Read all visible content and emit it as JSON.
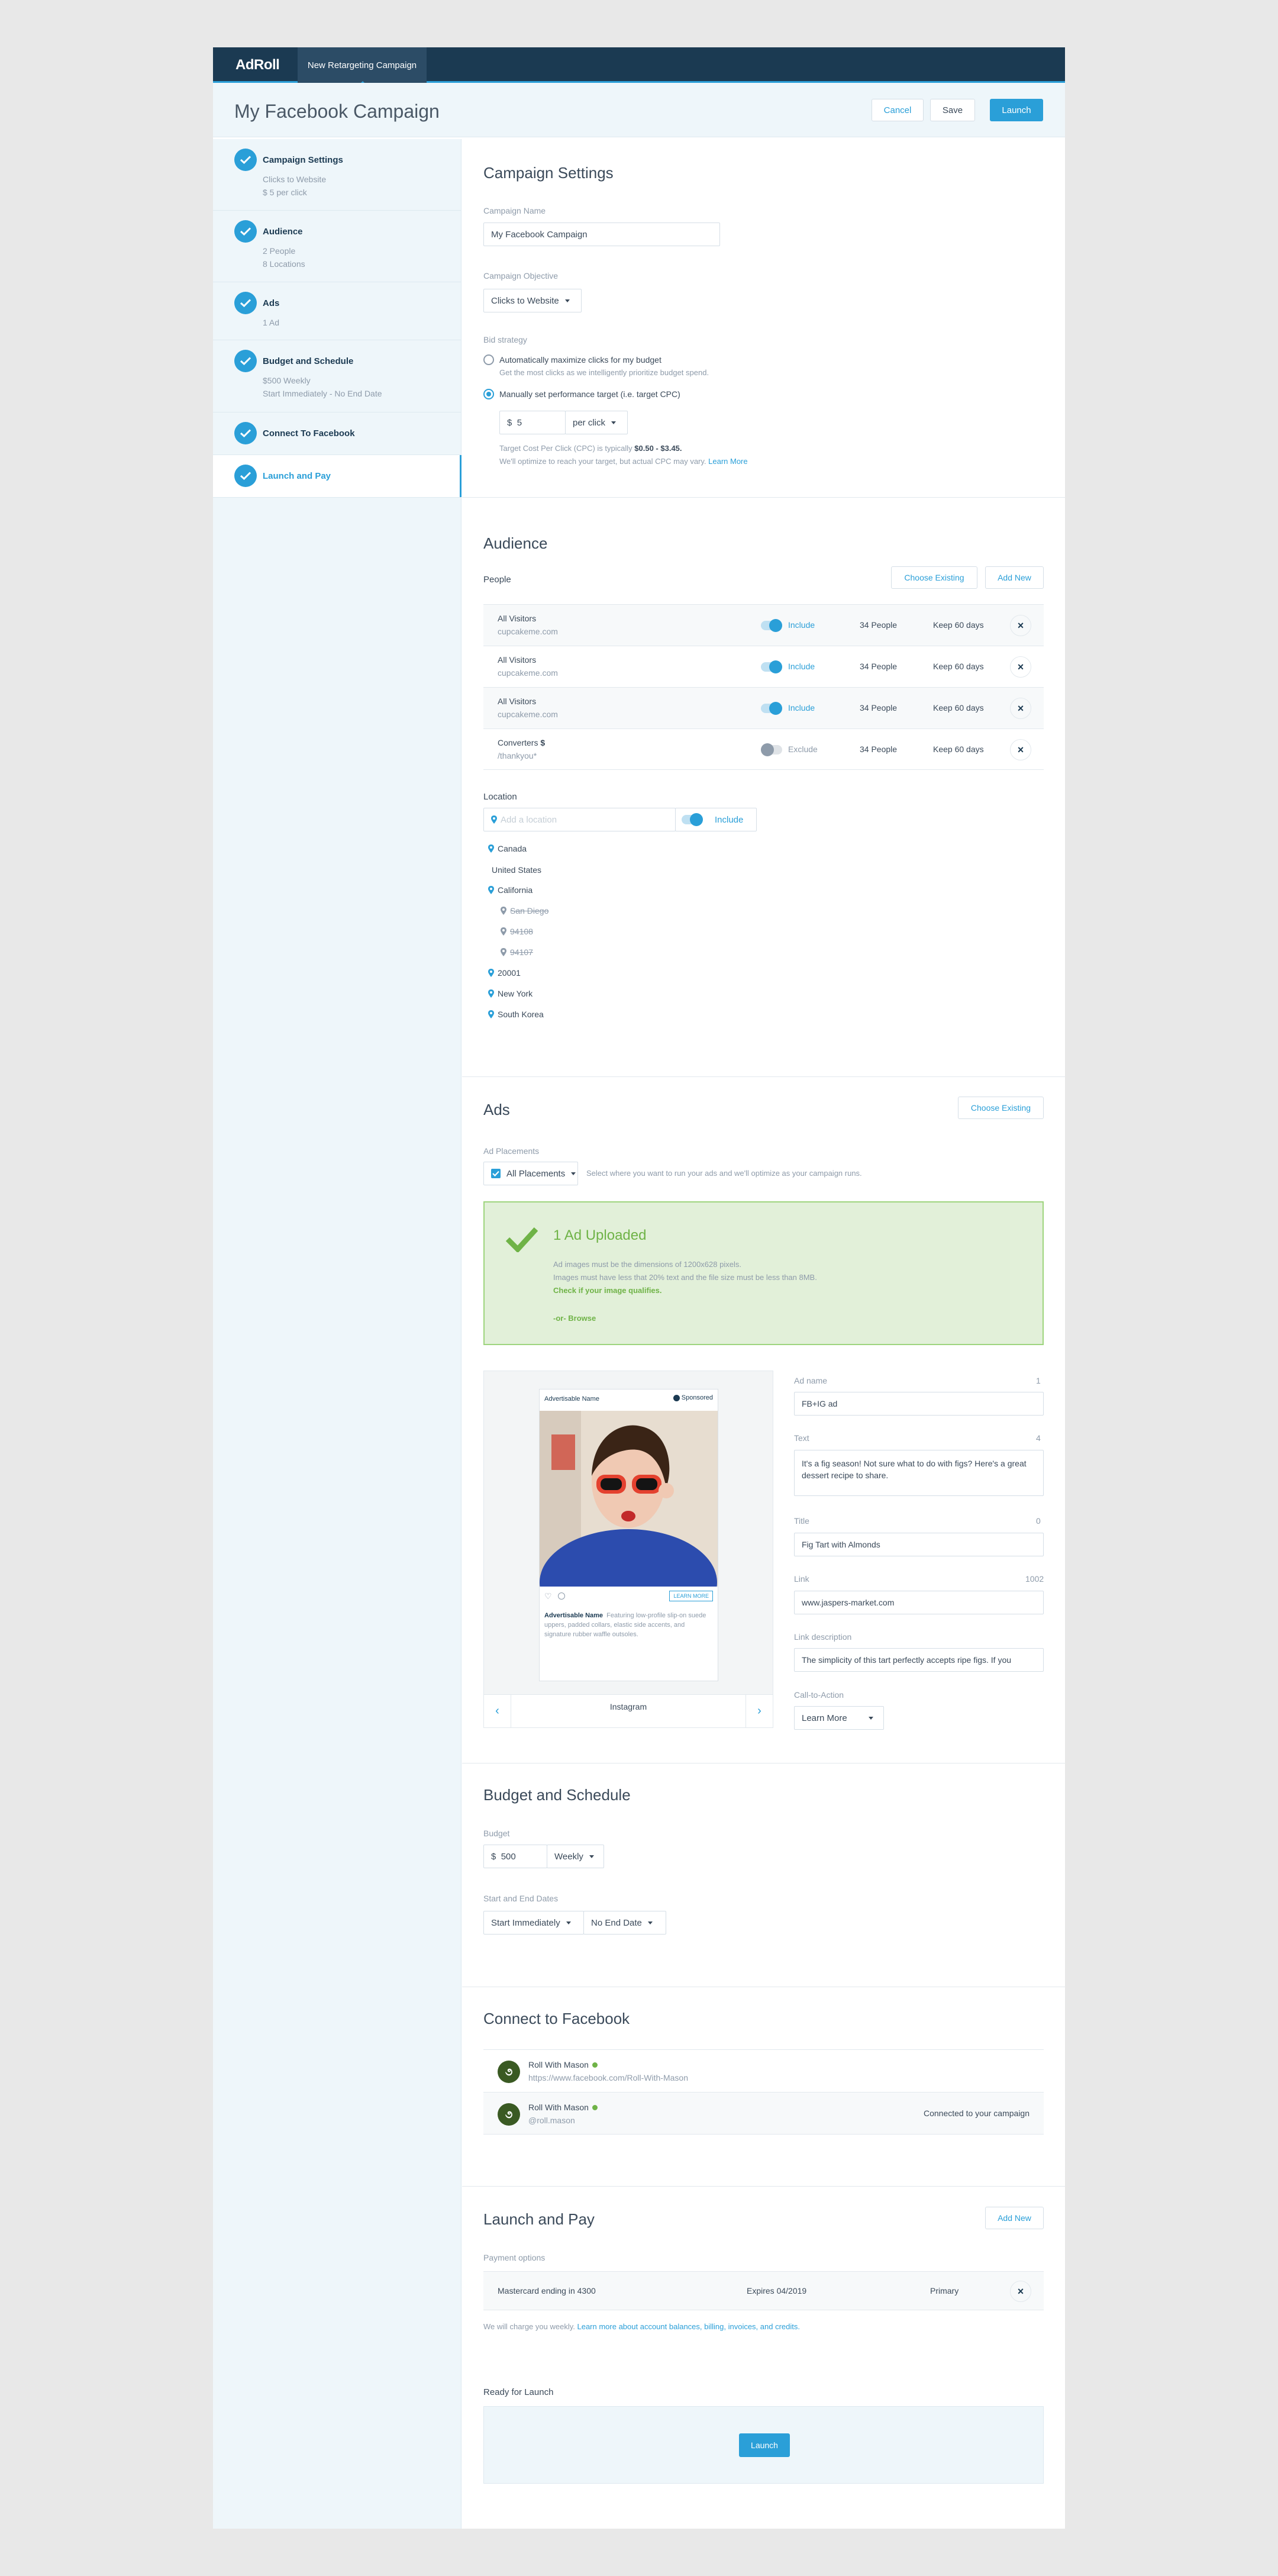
{
  "topbar": {
    "logo": "AdRoll",
    "tab": "New Retargeting Campaign"
  },
  "header": {
    "title": "My Facebook Campaign",
    "cancel": "Cancel",
    "save": "Save",
    "launch": "Launch"
  },
  "sidebar": {
    "steps": [
      {
        "title": "Campaign Settings",
        "sub1": "Clicks to Website",
        "sub2": "$ 5 per click"
      },
      {
        "title": "Audience",
        "sub1": "2 People",
        "sub2": "8 Locations"
      },
      {
        "title": "Ads",
        "sub1": "1 Ad",
        "sub2": ""
      },
      {
        "title": "Budget and Schedule",
        "sub1": "$500 Weekly",
        "sub2": "Start Immediately - No End Date"
      },
      {
        "title": "Connect To Facebook",
        "sub1": "",
        "sub2": ""
      },
      {
        "title": "Launch and Pay",
        "sub1": "",
        "sub2": ""
      }
    ]
  },
  "campaign": {
    "title": "Campaign Settings",
    "name_label": "Campaign Name",
    "name_value": "My Facebook Campaign",
    "objective_label": "Campaign Objective",
    "objective_value": "Clicks to Website",
    "bid_label": "Bid strategy",
    "opt1": "Automatically maximize clicks for my budget",
    "opt1_sub": "Get the most clicks as we intelligently prioritize budget spend.",
    "opt2": "Manually set performance target (i.e. target CPC)",
    "bid_currency": "$",
    "bid_value": "5",
    "bid_unit": "per click",
    "note1": "Target Cost Per Click (CPC) is typically ",
    "note1_bold": "$0.50 - $3.45.",
    "note2": "We'll optimize to reach your target, but actual CPC may vary. ",
    "learn_more": "Learn More"
  },
  "audience": {
    "title": "Audience",
    "people_label": "People",
    "choose_existing": "Choose Existing",
    "add_new": "Add New",
    "rows": [
      {
        "name": "All Visitors",
        "site": "cupcakeme.com",
        "state": "Include",
        "people": "34 People",
        "keep": "Keep 60 days"
      },
      {
        "name": "All Visitors",
        "site": "cupcakeme.com",
        "state": "Include",
        "people": "34 People",
        "keep": "Keep 60 days"
      },
      {
        "name": "All Visitors",
        "site": "cupcakeme.com",
        "state": "Include",
        "people": "34 People",
        "keep": "Keep 60 days"
      },
      {
        "name": "Converters",
        "site": "/thankyou*",
        "state": "Exclude",
        "people": "34 People",
        "keep": "Keep 60 days"
      }
    ],
    "location_label": "Location",
    "location_placeholder": "Add a location",
    "location_state": "Include",
    "locations": {
      "canada": "Canada",
      "us": "United States",
      "california": "California",
      "sandiego": "San Diego",
      "zip1": "94108",
      "zip2": "94107",
      "zip3": "20001",
      "newyork": "New York",
      "korea": "South Korea"
    }
  },
  "ads": {
    "title": "Ads",
    "choose_existing": "Choose Existing",
    "placements_label": "Ad Placements",
    "placements_value": "All Placements",
    "placements_hint": "Select where you want to run your ads and we'll optimize as your campaign runs.",
    "upload_title": "1 Ad Uploaded",
    "upload_line1": "Ad images must be the dimensions of 1200x628 pixels.",
    "upload_line2": "Images must have less that 20% text and the file size must be less than 8MB.",
    "upload_line3": "Check if your image qualifies.",
    "upload_browse": "-or- Browse",
    "card_name": "Advertisable Name",
    "card_sponsored": "Sponsored",
    "card_cta": "LEARN MORE",
    "card_body_name": "Advertisable Name",
    "card_body": "Featuring low-profile slip-on suede uppers, padded collars, elastic side accents, and signature rubber waffle outsoles.",
    "preview_platform": "Instagram",
    "fields": {
      "adname_label": "Ad name",
      "adname_count": "1",
      "adname_value": "FB+IG ad",
      "text_label": "Text",
      "text_count": "4",
      "text_value": "It's a fig season! Not sure what to do with figs? Here's a great dessert recipe to share.",
      "title_label": "Title",
      "title_count": "0",
      "title_value": "Fig Tart with Almonds",
      "link_label": "Link",
      "link_count": "1002",
      "link_value": "www.jaspers-market.com",
      "linkdesc_label": "Link description",
      "linkdesc_value": "The simplicity of this tart perfectly accepts ripe figs. If you",
      "cta_label": "Call-to-Action",
      "cta_value": "Learn More"
    }
  },
  "budget": {
    "title": "Budget and Schedule",
    "budget_label": "Budget",
    "currency": "$",
    "amount": "500",
    "period": "Weekly",
    "dates_label": "Start and End Dates",
    "start": "Start Immediately",
    "end": "No End Date"
  },
  "facebook": {
    "title": "Connect to Facebook",
    "accounts": [
      {
        "name": "Roll With Mason",
        "handle": "https://www.facebook.com/Roll-With-Mason",
        "status": ""
      },
      {
        "name": "Roll With Mason",
        "handle": "@roll.mason",
        "status": "Connected to your campaign"
      }
    ]
  },
  "launch": {
    "title": "Launch and Pay",
    "add_new": "Add New",
    "payment_label": "Payment options",
    "card": "Mastercard ending in 4300",
    "expires": "Expires 04/2019",
    "primary": "Primary",
    "note": "We will charge you weekly. ",
    "note_link": "Learn more about account balances, billing, invoices, and credits.",
    "ready_label": "Ready for Launch",
    "launch_button": "Launch"
  },
  "colors": {
    "accent": "#2a9fd8",
    "navy": "#1b3a52",
    "success_bg": "#e2f0d9",
    "success": "#6fb347",
    "sidebar_bg": "#eef6fa"
  }
}
